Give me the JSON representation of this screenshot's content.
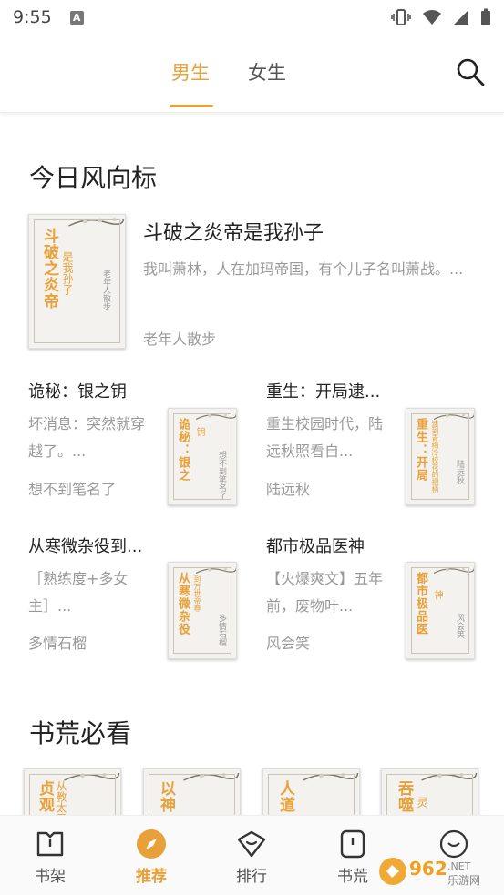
{
  "status": {
    "time": "9:55",
    "a_badge": "A"
  },
  "tabs": {
    "male": "男生",
    "female": "女生"
  },
  "sections": {
    "trend_title": "今日风向标",
    "must_read_title": "书荒必看"
  },
  "featured": {
    "title": "斗破之炎帝是我孙子",
    "desc": "我叫萧林，人在加玛帝国，有个儿子名叫萧战。...",
    "author": "老年人散步",
    "cover_title": "斗破之炎帝",
    "cover_sub": "是我孙子",
    "cover_author": "老年人散步"
  },
  "books": [
    {
      "title": "诡秘：银之钥",
      "desc": "坏消息：突然就穿越了。...",
      "author": "想不到笔名了",
      "cover_title": "诡秘：银之",
      "cover_sub": "钥",
      "cover_author": "想不到笔名了"
    },
    {
      "title": "重生：开局逮...",
      "desc": "重生校园时代，陆远秋照看自...",
      "author": "陆远秋",
      "cover_title": "重生：开局",
      "cover_sub": "逮到青梅冷校花的把柄",
      "cover_author": "陆远秋"
    },
    {
      "title": "从寒微杂役到...",
      "desc": "［熟练度+多女主］...",
      "author": "多情石榴",
      "cover_title": "从寒微杂役",
      "cover_sub": "到万世帝尊",
      "cover_author": "多情石榴"
    },
    {
      "title": "都市极品医神",
      "desc": "【火爆爽文】五年前，废物叶...",
      "author": "风会笑",
      "cover_title": "都市极品医",
      "cover_sub": "神",
      "cover_author": "风会笑"
    }
  ],
  "must_read": [
    {
      "cover_title": "贞观",
      "cover_sub": "从教太子"
    },
    {
      "cover_title": "以神",
      "cover_sub": ""
    },
    {
      "cover_title": "人道",
      "cover_sub": ""
    },
    {
      "cover_title": "吞噬",
      "cover_sub": "灵"
    }
  ],
  "nav": {
    "shelf": "书架",
    "recommend": "推荐",
    "rank": "排行",
    "shortage": "书荒",
    "more": ""
  },
  "watermark_text": "962.NET 乐游网",
  "colors": {
    "accent": "#e8a13a",
    "muted": "#999999"
  }
}
